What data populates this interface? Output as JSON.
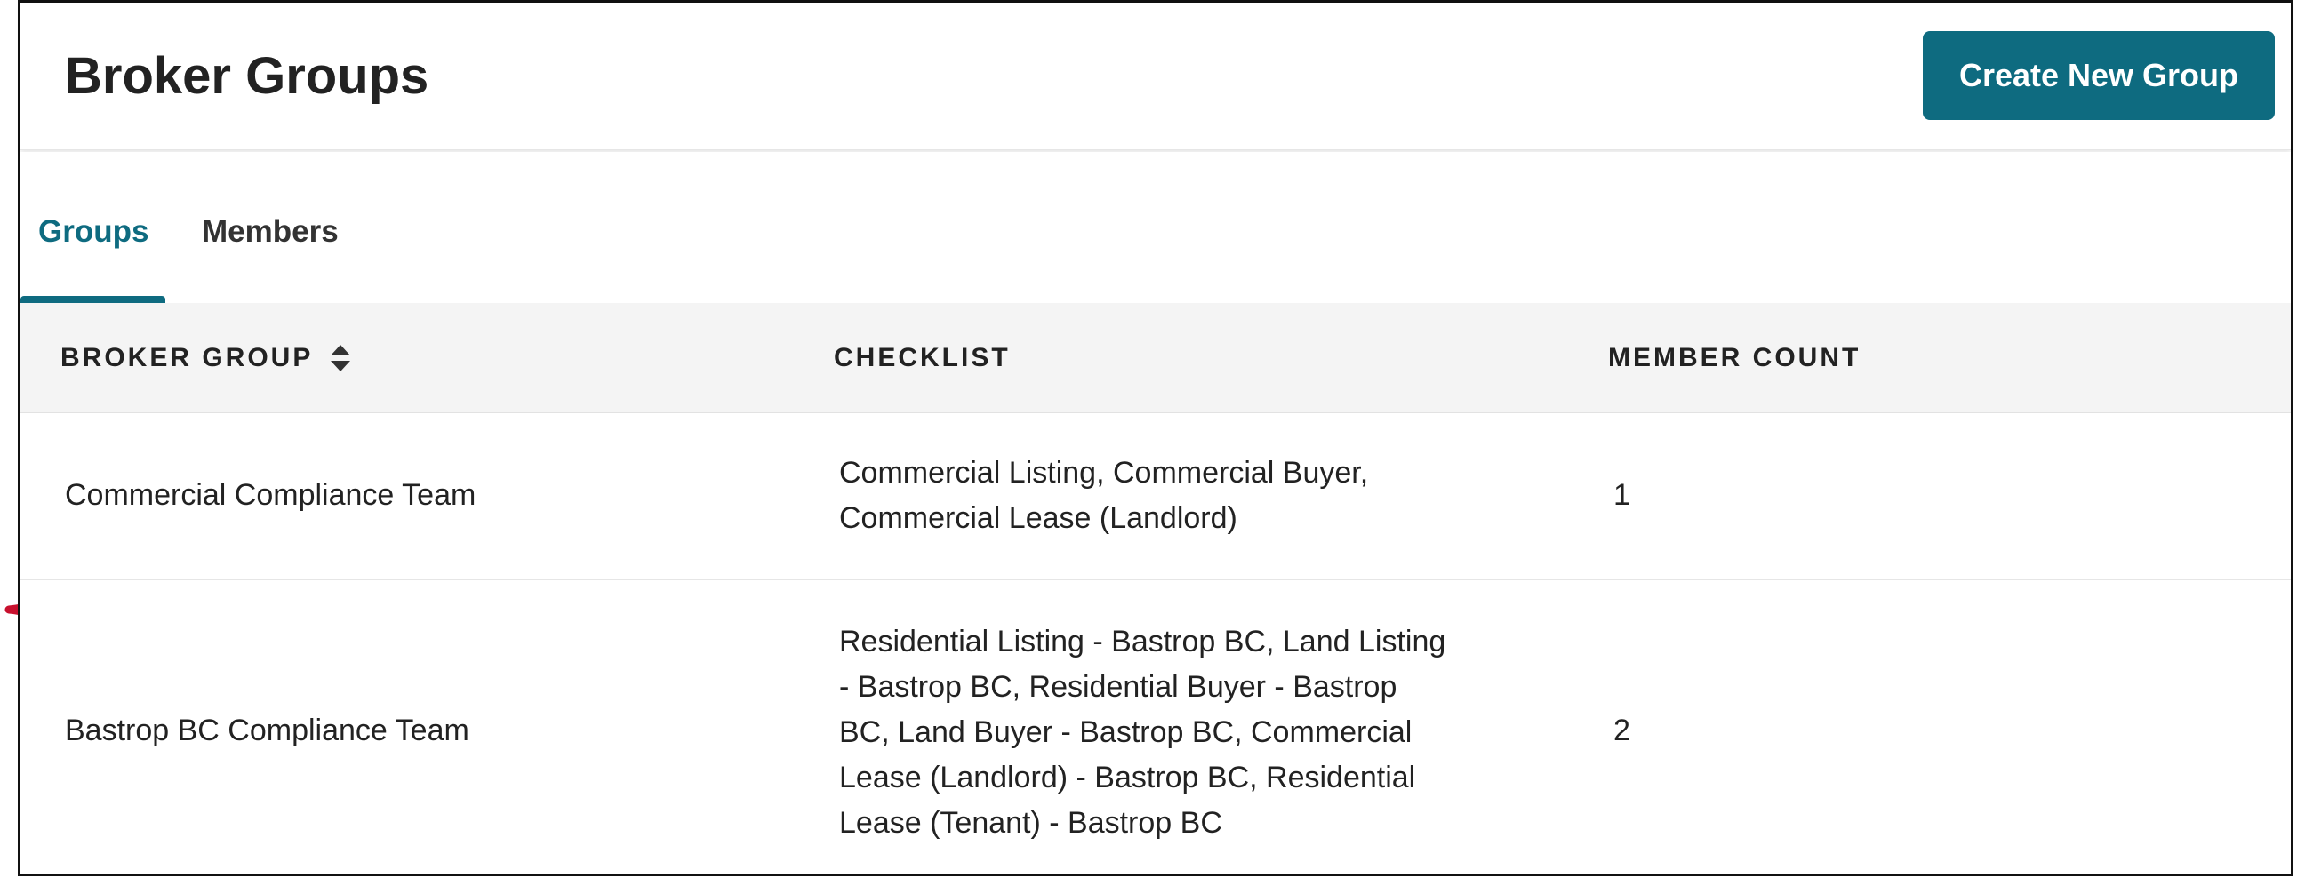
{
  "header": {
    "title": "Broker Groups",
    "create_button_label": "Create New Group"
  },
  "tabs": [
    {
      "label": "Groups",
      "active": true
    },
    {
      "label": "Members",
      "active": false
    }
  ],
  "table": {
    "columns": [
      "BROKER GROUP",
      "CHECKLIST",
      "MEMBER COUNT"
    ],
    "sort_icon": "sort-updown-icon",
    "rows": [
      {
        "group": "Commercial Compliance Team",
        "checklist_lines": [
          "Commercial Listing, Commercial Buyer,",
          "Commercial Lease (Landlord)"
        ],
        "member_count": "1"
      },
      {
        "group": "Bastrop BC Compliance Team",
        "checklist_lines": [
          "Residential Listing - Bastrop BC, Land Listing",
          "- Bastrop BC, Residential Buyer - Bastrop",
          "BC, Land Buyer - Bastrop BC, Commercial",
          "Lease (Landlord) - Bastrop BC, Residential",
          "Lease (Tenant) - Bastrop BC"
        ],
        "member_count": "2"
      }
    ]
  },
  "annotation": {
    "type": "curly-brace",
    "color": "#c8102e"
  },
  "colors": {
    "accent": "#0e6b80",
    "header_bg": "#f4f4f4"
  }
}
